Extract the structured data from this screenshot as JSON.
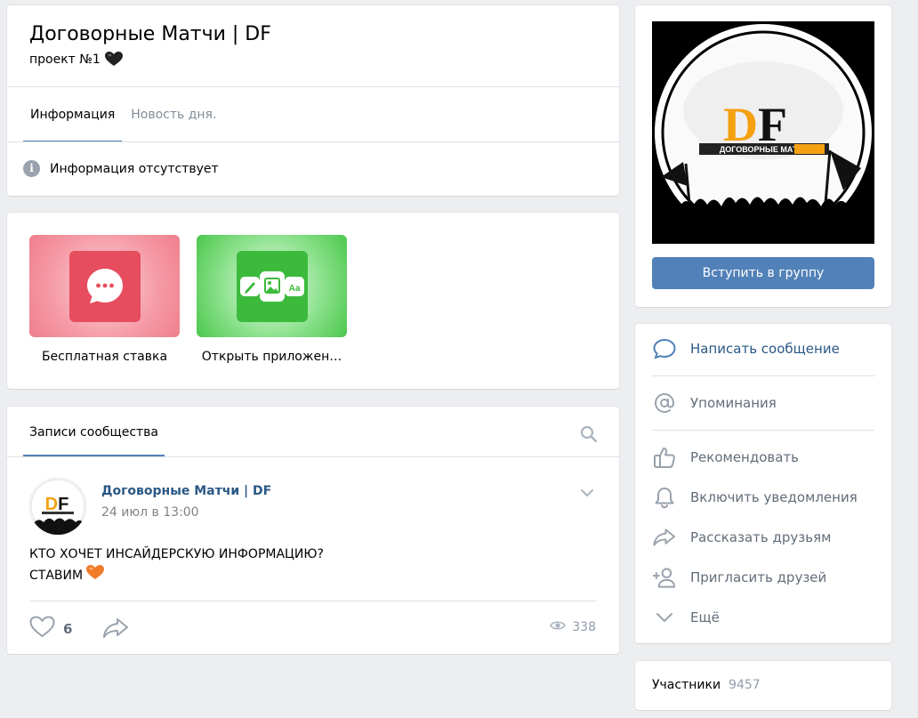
{
  "header": {
    "title": "Договорные Матчи | DF",
    "status": "проект №1",
    "status_emoji": "black-heart-icon",
    "tabs": [
      {
        "label": "Информация",
        "active": true
      },
      {
        "label": "Новость дня.",
        "active": false
      }
    ],
    "info_text": "Информация отсутствует"
  },
  "apps": [
    {
      "label": "Бесплатная ставка",
      "icon": "chat-bubble-icon",
      "color": "#e64d5e"
    },
    {
      "label": "Открыть приложен…",
      "icon": "editor-tools-icon",
      "color": "#4bb34b"
    }
  ],
  "posts": {
    "tab_label": "Записи сообщества",
    "post": {
      "author": "Договорные Матчи | DF",
      "date": "24 июл в 13:00",
      "text_line1": "КТО ХОЧЕТ ИНСАЙДЕРСКУЮ ИНФОРМАЦИЮ?",
      "text_line2": "СТАВИМ",
      "likes": "6",
      "views": "338"
    }
  },
  "sidebar": {
    "cover": {
      "logo_text": "DF",
      "logo_subtext": "ДОГОВОРНЫЕ МАТЧИ"
    },
    "join_label": "Вступить в группу",
    "actions": [
      {
        "label": "Написать сообщение",
        "icon": "message-icon"
      },
      {
        "label": "Упоминания",
        "icon": "at-icon"
      },
      {
        "label": "Рекомендовать",
        "icon": "thumbs-up-icon"
      },
      {
        "label": "Включить уведомления",
        "icon": "bell-icon"
      },
      {
        "label": "Рассказать друзьям",
        "icon": "share-icon"
      },
      {
        "label": "Пригласить друзей",
        "icon": "add-user-icon"
      },
      {
        "label": "Ещё",
        "icon": "chevron-down-icon"
      }
    ],
    "members_label": "Участники",
    "members_count": "9457"
  },
  "colors": {
    "accent": "#5181b8",
    "link": "#2a5885",
    "background": "#edeef0"
  }
}
